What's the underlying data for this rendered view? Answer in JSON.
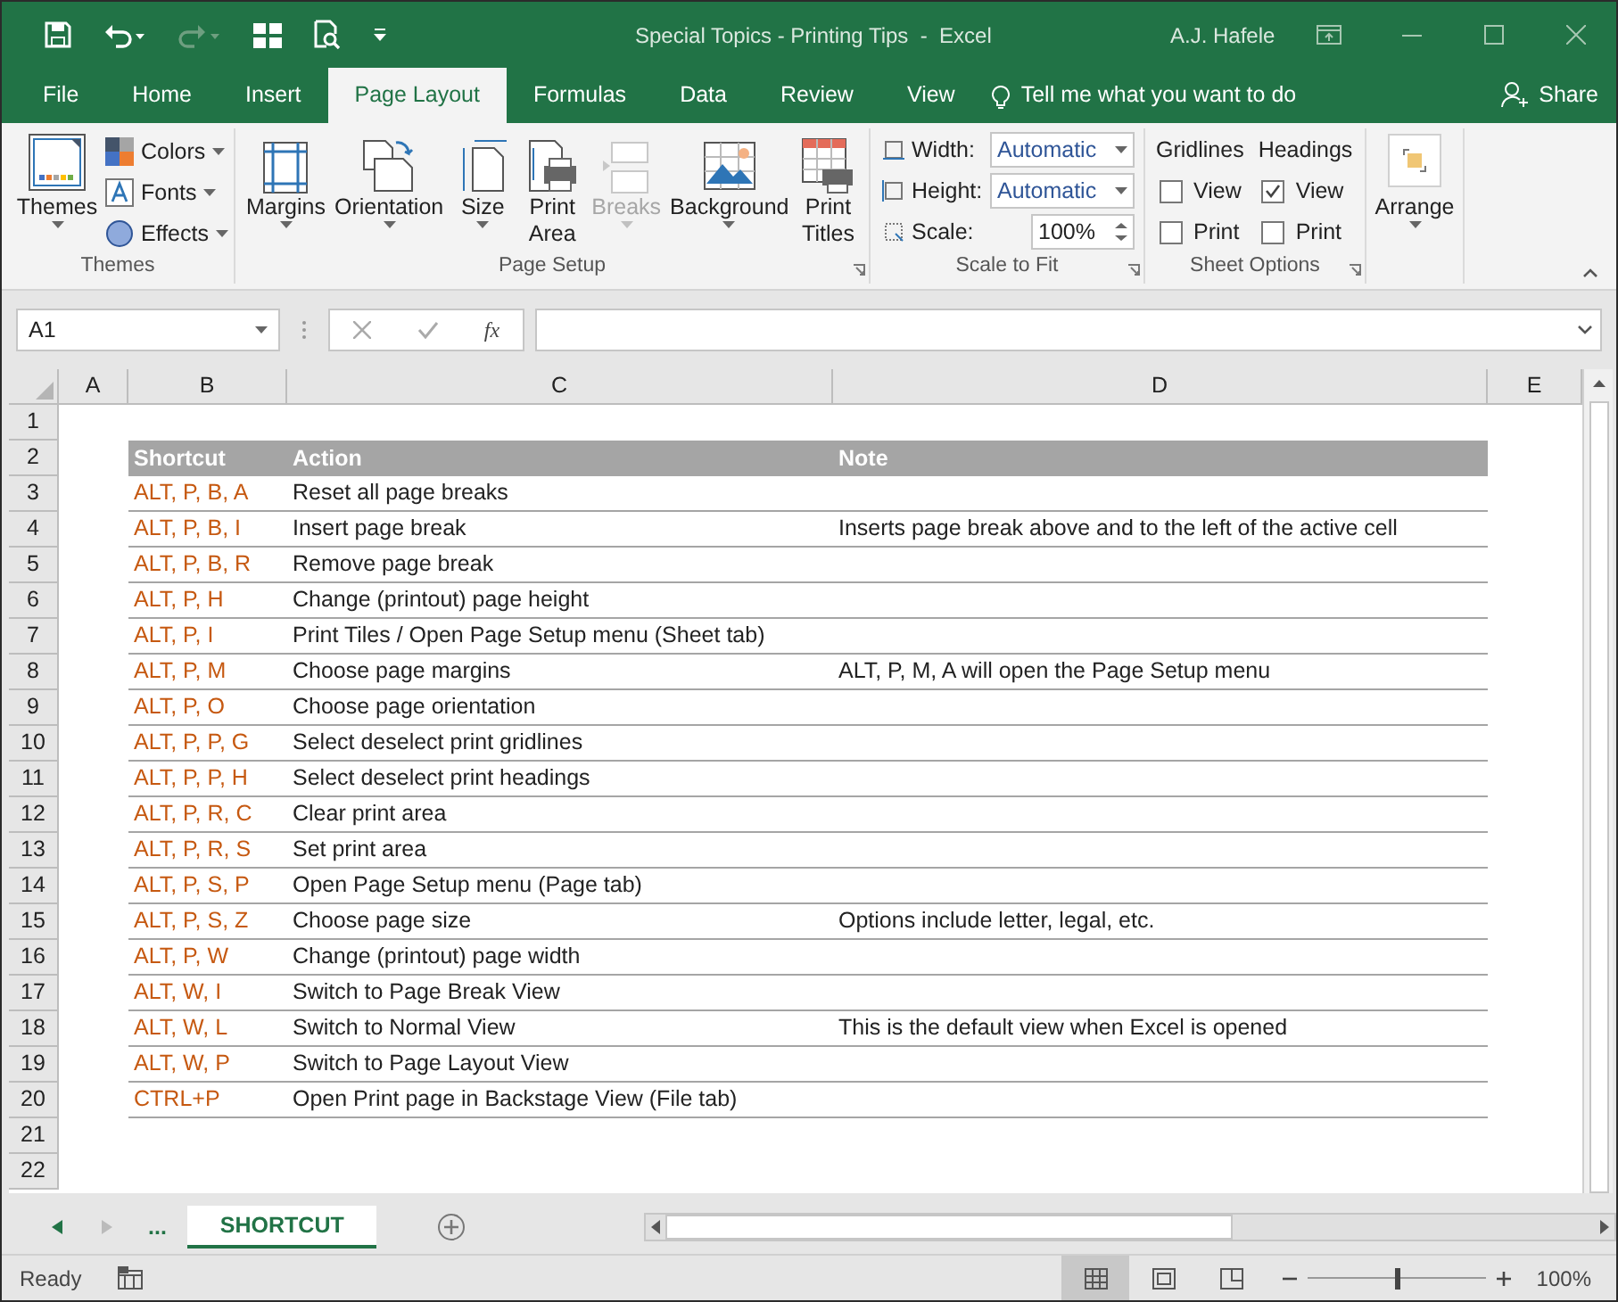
{
  "title_bar": {
    "title": "Special Topics - Printing Tips  -  Excel",
    "user": "A.J. Hafele"
  },
  "tabs": [
    {
      "label": "File",
      "selected": false
    },
    {
      "label": "Home",
      "selected": false
    },
    {
      "label": "Insert",
      "selected": false
    },
    {
      "label": "Page Layout",
      "selected": true
    },
    {
      "label": "Formulas",
      "selected": false
    },
    {
      "label": "Data",
      "selected": false
    },
    {
      "label": "Review",
      "selected": false
    },
    {
      "label": "View",
      "selected": false
    }
  ],
  "tell_me": "Tell me what you want to do",
  "share": "Share",
  "ribbon": {
    "themes": {
      "label": "Themes",
      "button": "Themes",
      "options": [
        "Colors",
        "Fonts",
        "Effects"
      ]
    },
    "page_setup": {
      "label": "Page Setup",
      "buttons": [
        {
          "kind": "margins",
          "lines": [
            "Margins"
          ],
          "disabled": false
        },
        {
          "kind": "orientation",
          "lines": [
            "Orientation"
          ],
          "disabled": false
        },
        {
          "kind": "size",
          "lines": [
            "Size"
          ],
          "disabled": false
        },
        {
          "kind": "print_area",
          "lines": [
            "Print",
            "Area"
          ],
          "disabled": false
        },
        {
          "kind": "breaks",
          "lines": [
            "Breaks"
          ],
          "disabled": true
        },
        {
          "kind": "background",
          "lines": [
            "Background"
          ],
          "disabled": false
        },
        {
          "kind": "print_titles",
          "lines": [
            "Print",
            "Titles"
          ],
          "disabled": false
        }
      ]
    },
    "scale_to_fit": {
      "label": "Scale to Fit",
      "width": {
        "label": "Width:",
        "value": "Automatic"
      },
      "height": {
        "label": "Height:",
        "value": "Automatic"
      },
      "scale": {
        "label": "Scale:",
        "value": "100%"
      }
    },
    "sheet_options": {
      "label": "Sheet Options",
      "groups": [
        {
          "heading": "Gridlines",
          "view": {
            "label": "View",
            "checked": false
          },
          "print": {
            "label": "Print",
            "checked": false
          }
        },
        {
          "heading": "Headings",
          "view": {
            "label": "View",
            "checked": true
          },
          "print": {
            "label": "Print",
            "checked": false
          }
        }
      ]
    },
    "arrange": {
      "label": "Arrange"
    }
  },
  "formula_bar": {
    "name_box": "A1",
    "function_label": "fx"
  },
  "columns": [
    "A",
    "B",
    "C",
    "D",
    "E"
  ],
  "rows": [
    {
      "number": "1",
      "kind": "blank"
    },
    {
      "number": "2",
      "kind": "header",
      "shortcut": "Shortcut",
      "action": "Action",
      "note": "Note"
    },
    {
      "number": "3",
      "kind": "data",
      "shortcut": "ALT, P, B, A",
      "action": "Reset all page breaks"
    },
    {
      "number": "4",
      "kind": "data",
      "shortcut": "ALT, P, B, I",
      "action": "Insert page break",
      "note": "Inserts page break above and to the left of the active cell"
    },
    {
      "number": "5",
      "kind": "data",
      "shortcut": "ALT, P, B, R",
      "action": "Remove page break"
    },
    {
      "number": "6",
      "kind": "data",
      "shortcut": "ALT, P, H",
      "action": "Change (printout) page height"
    },
    {
      "number": "7",
      "kind": "data",
      "shortcut": "ALT, P, I",
      "action": "Print Tiles / Open Page Setup menu (Sheet tab)"
    },
    {
      "number": "8",
      "kind": "data",
      "shortcut": "ALT, P, M",
      "action": "Choose page margins",
      "note": "ALT, P, M, A will open the Page Setup menu"
    },
    {
      "number": "9",
      "kind": "data",
      "shortcut": "ALT, P, O",
      "action": "Choose page orientation"
    },
    {
      "number": "10",
      "kind": "data",
      "shortcut": "ALT, P, P, G",
      "action": "Select deselect print gridlines"
    },
    {
      "number": "11",
      "kind": "data",
      "shortcut": "ALT, P, P, H",
      "action": "Select deselect print headings"
    },
    {
      "number": "12",
      "kind": "data",
      "shortcut": "ALT, P, R, C",
      "action": "Clear print area"
    },
    {
      "number": "13",
      "kind": "data",
      "shortcut": "ALT, P, R, S",
      "action": "Set print area"
    },
    {
      "number": "14",
      "kind": "data",
      "shortcut": "ALT, P, S, P",
      "action": "Open Page Setup menu (Page tab)"
    },
    {
      "number": "15",
      "kind": "data",
      "shortcut": "ALT, P, S, Z",
      "action": "Choose page size",
      "note": "Options include letter, legal, etc."
    },
    {
      "number": "16",
      "kind": "data",
      "shortcut": "ALT, P, W",
      "action": "Change (printout) page width"
    },
    {
      "number": "17",
      "kind": "data",
      "shortcut": "ALT, W, I",
      "action": "Switch to Page Break View"
    },
    {
      "number": "18",
      "kind": "data",
      "shortcut": "ALT, W, L",
      "action": "Switch to Normal View",
      "note": "This is the default view when Excel is opened"
    },
    {
      "number": "19",
      "kind": "data",
      "shortcut": "ALT, W, P",
      "action": "Switch to Page Layout View"
    },
    {
      "number": "20",
      "kind": "data",
      "shortcut": "CTRL+P",
      "action": "Open Print page in Backstage View (File tab)"
    },
    {
      "number": "21",
      "kind": "blank"
    },
    {
      "number": "22",
      "kind": "blank"
    }
  ],
  "sheet_tabs": {
    "more": "...",
    "tabs": [
      {
        "label": "SHORTCUT",
        "selected": true
      }
    ]
  },
  "status_bar": {
    "status": "Ready",
    "views": [
      {
        "kind": "normal",
        "selected": true
      },
      {
        "kind": "page_layout",
        "selected": false
      },
      {
        "kind": "page_break",
        "selected": false
      }
    ],
    "zoom": {
      "level": 0.5,
      "reading": "100%"
    }
  }
}
